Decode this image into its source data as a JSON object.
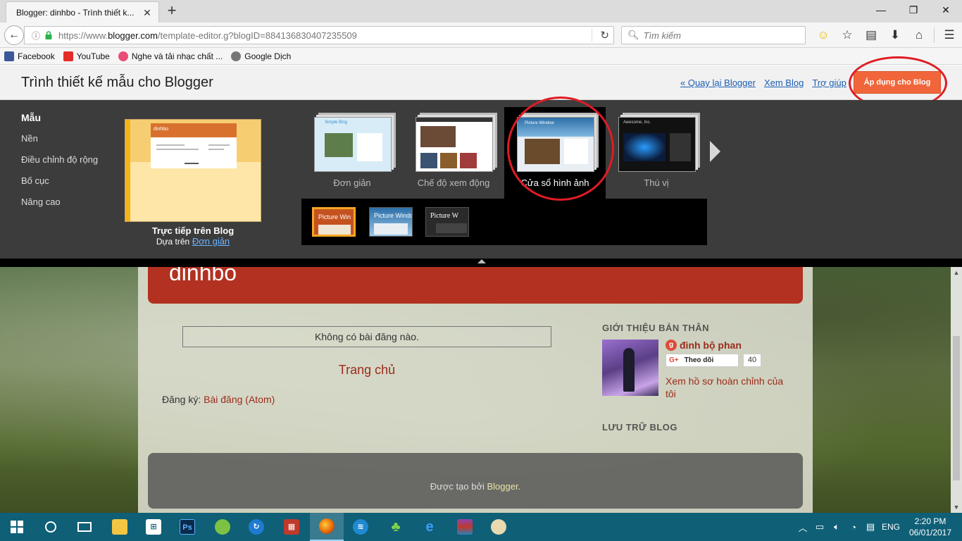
{
  "browser": {
    "tab_title": "Blogger: dinhbo - Trình thiết k...",
    "url_scheme": "https://www.",
    "url_host": "blogger.com",
    "url_path": "/template-editor.g?blogID=884136830407235509",
    "search_placeholder": "Tìm kiếm",
    "bookmarks": [
      {
        "label": "Facebook",
        "icon": "facebook-icon",
        "color": "#3b5998"
      },
      {
        "label": "YouTube",
        "icon": "youtube-icon",
        "color": "#e52d27"
      },
      {
        "label": "Nghe và tải nhạc chất ...",
        "icon": "music-icon",
        "color": "#e94e77"
      },
      {
        "label": "Google Dịch",
        "icon": "translate-icon",
        "color": "#555555"
      }
    ]
  },
  "designer": {
    "title": "Trình thiết kế mẫu cho Blogger",
    "links": [
      "« Quay lại Blogger",
      "Xem Blog",
      "Trợ giúp"
    ],
    "apply_label": "Áp dụng cho Blog",
    "menu": [
      "Mẫu",
      "Nền",
      "Điều chỉnh độ rộng",
      "Bố cục",
      "Nâng cao"
    ],
    "preview": {
      "blog_name": "dinhbo",
      "caption_title": "Trực tiếp trên Blog",
      "based_on_prefix": "Dựa trên",
      "based_on_link": "Đơn giản"
    },
    "templates": [
      {
        "label": "Đơn giản",
        "thumb_text": "Simple Blog"
      },
      {
        "label": "Chế độ xem động",
        "thumb_text": ""
      },
      {
        "label": "Cửa sổ hình ảnh",
        "thumb_text": "Picture Window"
      },
      {
        "label": "Thú vị",
        "thumb_text": "Awesome, Inc."
      }
    ],
    "variants": [
      "Picture Win",
      "Picture Window",
      "Picture W"
    ]
  },
  "blog": {
    "name": "dinhbo",
    "no_posts": "Không có bài đăng nào.",
    "home": "Trang chủ",
    "subscribe_prefix": "Đăng ký:",
    "subscribe_link": "Bài đăng (Atom)",
    "about_title": "GIỚI THIỆU BẢN THÂN",
    "profile_name": "đinh bộ phan",
    "follow_label": "Theo dõi",
    "follow_count": "40",
    "profile_link": "Xem hồ sơ hoàn chỉnh của tôi",
    "archive_title": "LƯU TRỮ BLOG",
    "footer_prefix": "Được tạo bởi",
    "footer_link": "Blogger."
  },
  "taskbar": {
    "language": "ENG",
    "time": "2:20 PM",
    "date": "06/01/2017"
  },
  "colors": {
    "apply_button": "#f0663a",
    "annotation_circle": "#e01b24",
    "blog_header": "#b23121",
    "taskbar": "#0f5f77"
  }
}
